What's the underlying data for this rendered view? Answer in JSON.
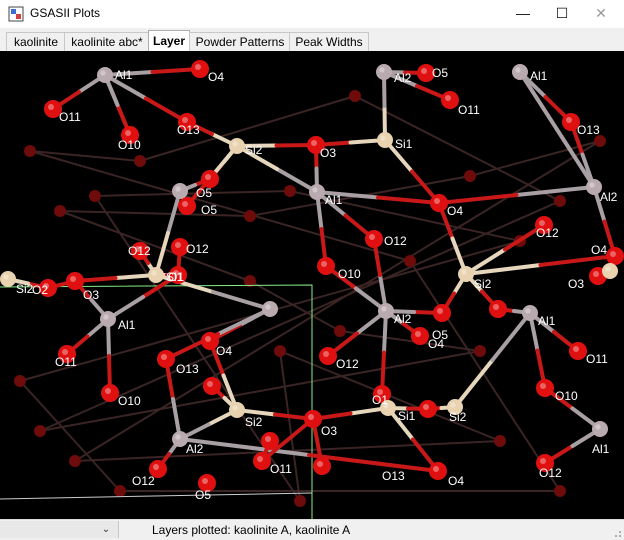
{
  "window": {
    "title": "GSASII Plots",
    "minimize_glyph": "—",
    "maximize_glyph": "☐",
    "close_glyph": "✕"
  },
  "tabs": [
    {
      "label": "kaolinite",
      "active": false
    },
    {
      "label": "kaolinite abc*",
      "active": false
    },
    {
      "label": "Layer",
      "active": true
    },
    {
      "label": "Powder Patterns",
      "active": false
    },
    {
      "label": "Peak Widths",
      "active": false
    }
  ],
  "status": {
    "selector_value": "",
    "text": "Layers plotted: kaolinite A, kaolinite A"
  },
  "icons": [
    "app-logo-icon",
    "minimize-icon",
    "maximize-icon",
    "close-icon",
    "chevron-down-icon",
    "size-grip-icon"
  ],
  "colors": {
    "oxygen": "#e01010",
    "oxygen_dark": "#6e0b0b",
    "aluminum": "#b9aab0",
    "silicon": "#e8d2b0",
    "potassium_dark": "#5a5046",
    "bond_o": "#c81818",
    "bond_al": "#a8a0a4",
    "bond_si": "#e6d6bc",
    "cell_edge": "#88ee88",
    "atom_label": "#ffffff"
  },
  "atom_labels": {
    "o1": "O1",
    "o2": "O2",
    "o3": "O3",
    "o4": "O4",
    "o5": "O5",
    "o10": "O10",
    "o11": "O11",
    "o12": "O12",
    "o13": "O13",
    "al1": "Al1",
    "al2": "Al2",
    "si1": "Si1",
    "si2": "Si2"
  }
}
